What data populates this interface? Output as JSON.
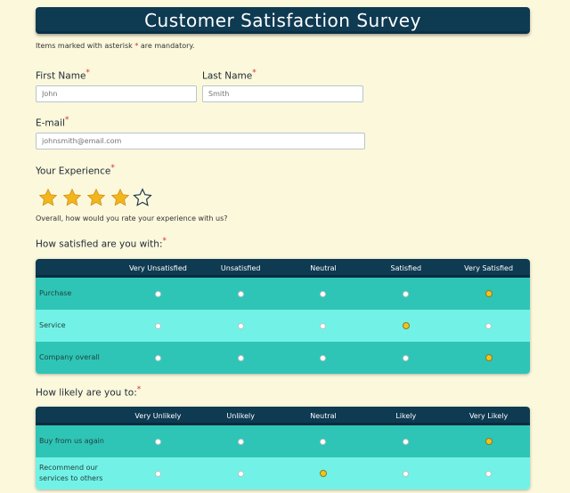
{
  "survey": {
    "title": "Customer Satisfaction Survey",
    "note_prefix": "Items marked with asterisk",
    "note_star": "*",
    "note_suffix": "are mandatory."
  },
  "fields": {
    "first_name_label": "First Name",
    "first_name_placeholder": "John",
    "last_name_label": "Last Name",
    "last_name_placeholder": "Smith",
    "email_label": "E-mail",
    "email_placeholder": "johnsmith@email.com",
    "required_mark": "*"
  },
  "experience": {
    "label": "Your Experience",
    "rating": 4,
    "max": 5,
    "hint": "Overall, how would you rate your experience with us?",
    "star_color": "#f2b51c"
  },
  "satisfaction": {
    "label": "How satisfied are you with:",
    "columns": [
      "Very Unsatisfied",
      "Unsatisfied",
      "Neutral",
      "Satisfied",
      "Very Satisfied"
    ],
    "rows": [
      {
        "label": "Purchase",
        "selected": 4
      },
      {
        "label": "Service",
        "selected": 3
      },
      {
        "label": "Company overall",
        "selected": 4
      }
    ]
  },
  "likelihood": {
    "label": "How likely are you to:",
    "columns": [
      "Very Unlikely",
      "Unlikely",
      "Neutral",
      "Likely",
      "Very Likely"
    ],
    "rows": [
      {
        "label": "Buy from us again",
        "selected": 4
      },
      {
        "label": "Recommend our services to others",
        "selected": 2
      }
    ]
  },
  "colors": {
    "header": "#0e3a52",
    "row_dark": "#2ec5b6",
    "row_light": "#72f2e6",
    "selected_radio": "#f0c419",
    "background": "#fbf8dc"
  }
}
